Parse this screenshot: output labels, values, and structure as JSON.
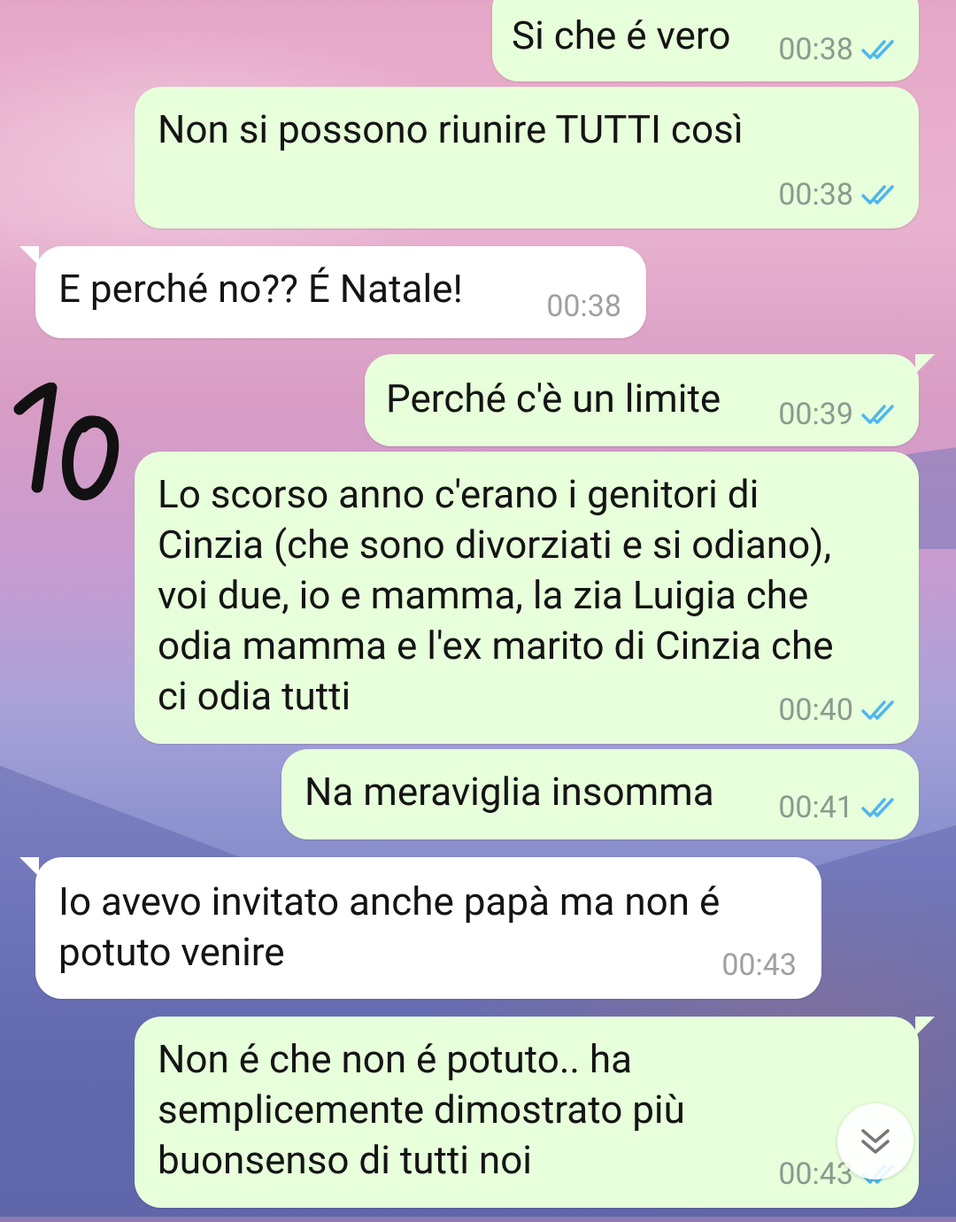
{
  "chat": {
    "messages": [
      {
        "side": "out",
        "text": "Si che é vero",
        "time": "00:38",
        "status": "read"
      },
      {
        "side": "out",
        "text": "Non si possono riunire TUTTI così",
        "time": "00:38",
        "status": "read"
      },
      {
        "side": "in",
        "text": "E perché no?? É Natale!",
        "time": "00:38"
      },
      {
        "side": "out",
        "text": "Perché c'è un limite",
        "time": "00:39",
        "status": "read"
      },
      {
        "side": "out",
        "text": "Lo scorso anno c'erano i genitori di\nCinzia (che sono divorziati e si odiano),\nvoi due, io e mamma, la zia Luigia che\nodia mamma e l'ex marito di Cinzia che\nci odia tutti",
        "time": "00:40",
        "status": "read"
      },
      {
        "side": "out",
        "text": "Na meraviglia insomma",
        "time": "00:41",
        "status": "read"
      },
      {
        "side": "in",
        "text": "Io avevo invitato anche papà ma non é\npotuto venire",
        "time": "00:43"
      },
      {
        "side": "out",
        "text": "Non é che non é potuto.. ha\nsemplicemente dimostrato più\nbuonsenso di tutti noi",
        "time": "00:43",
        "status": "read"
      }
    ]
  },
  "overlay": {
    "handwritten_number": "10"
  },
  "colors": {
    "outgoing_bubble": "#e7ffdb",
    "incoming_bubble": "#ffffff",
    "read_ticks": "#4fb6ec",
    "timestamp": "#8c9a8e"
  },
  "icons": {
    "read_receipt": "double-check-icon",
    "scroll_down": "chevron-down-double-icon"
  }
}
